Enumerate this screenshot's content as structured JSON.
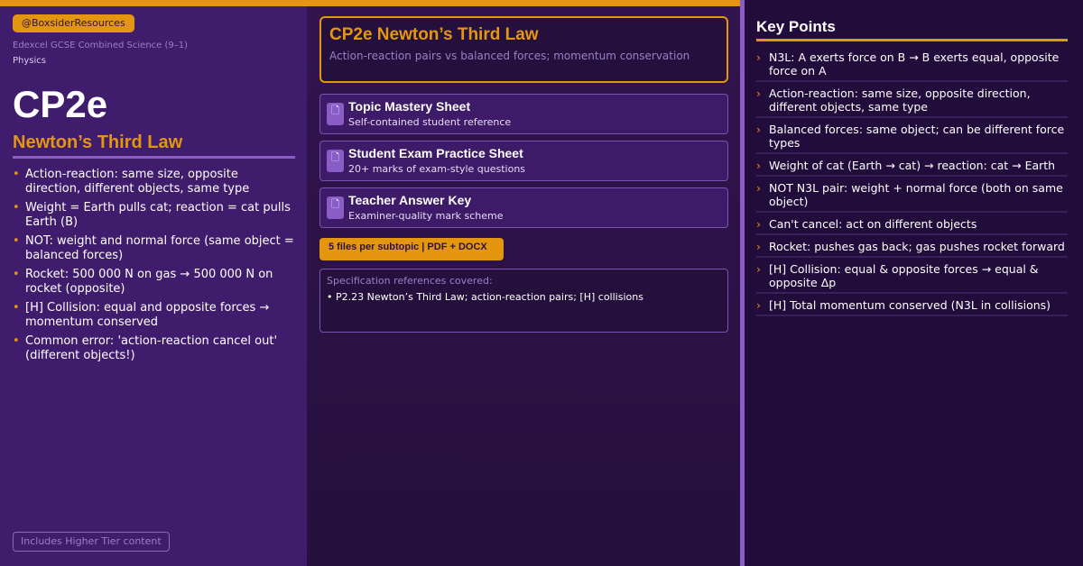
{
  "brand": {
    "handle": "@BoxsiderResources",
    "board": "Edexcel GCSE Combined Science (9–1)",
    "subject": "Physics"
  },
  "topic": {
    "code": "CP2e",
    "title": "Newton’s Third Law",
    "summary": [
      "Action-reaction: same size, opposite direction, different objects, same type",
      "Weight = Earth pulls cat; reaction = cat pulls Earth (B)",
      "NOT: weight and normal force (same object = balanced forces)",
      "Rocket: 500 000 N on gas → 500 000 N on rocket (opposite)",
      "[H] Collision: equal and opposite forces → momentum conserved",
      "Common error: 'action-reaction cancel out' (different objects!)"
    ],
    "tier_badge": "Includes Higher Tier content"
  },
  "header": {
    "title": "CP2e Newton’s Third Law",
    "subtitle": "Action-reaction pairs vs balanced forces; momentum conservation"
  },
  "files": [
    {
      "icon": "document-icon",
      "glyph": "🗋",
      "title": "Topic Mastery Sheet",
      "desc": "Self-contained student reference"
    },
    {
      "icon": "document-icon",
      "glyph": "🗋",
      "title": "Student Exam Practice Sheet",
      "desc": "20+ marks of exam-style questions"
    },
    {
      "icon": "document-icon",
      "glyph": "🗋",
      "title": "Teacher Answer Key",
      "desc": "Examiner-quality mark scheme"
    }
  ],
  "files_badge": "5 files per subtopic  |  PDF + DOCX",
  "spec": {
    "heading": "Specification references covered:",
    "refs": [
      "• P2.23  Newton’s Third Law; action-reaction pairs; [H] collisions"
    ]
  },
  "key_points": {
    "title": "Key Points",
    "items": [
      "N3L: A exerts force on B → B exerts equal, opposite force on A",
      "Action-reaction: same size, opposite direction, different objects, same type",
      "Balanced forces: same object; can be different force types",
      "Weight of cat (Earth → cat) → reaction: cat → Earth",
      "NOT N3L pair: weight + normal force (both on same object)",
      "Can't cancel: act on different objects",
      "Rocket: pushes gas back; gas pushes rocket forward",
      "[H] Collision: equal & opposite forces → equal & opposite Δp",
      "[H] Total momentum conserved (N3L in collisions)"
    ]
  },
  "colors": {
    "accent": "#e4960f",
    "left_panel": "#401c6c",
    "right_panel": "#220c3c",
    "divider": "#8a5cc6"
  }
}
